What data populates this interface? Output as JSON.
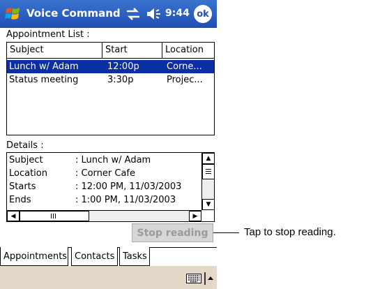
{
  "titlebar": {
    "title": "Voice Command",
    "time": "9:44",
    "ok_label": "ok"
  },
  "appointment_list": {
    "label": "Appointment List :",
    "columns": [
      "Subject",
      "Start",
      "Location"
    ],
    "rows": [
      {
        "subject": "Lunch w/ Adam",
        "start": "12:00p",
        "location": "Corne...",
        "selected": true
      },
      {
        "subject": "Status meeting",
        "start": "3:30p",
        "location": "Projec...",
        "selected": false
      }
    ]
  },
  "details": {
    "label": "Details :",
    "rows": [
      {
        "key": "Subject",
        "value": ": Lunch w/ Adam"
      },
      {
        "key": "Location",
        "value": ": Corner Cafe"
      },
      {
        "key": "Starts",
        "value": ": 12:00 PM, 11/03/2003"
      },
      {
        "key": "Ends",
        "value": ": 1:00 PM, 11/03/2003"
      }
    ]
  },
  "stop_button": {
    "label": "Stop reading"
  },
  "callout": {
    "text": "Tap to stop reading."
  },
  "tabs": [
    "Appointments",
    "Contacts",
    "Tasks"
  ],
  "colors": {
    "titlebar": "#1f4fb3",
    "selection": "#0c2ea3",
    "menubar": "#e4d8c8"
  }
}
